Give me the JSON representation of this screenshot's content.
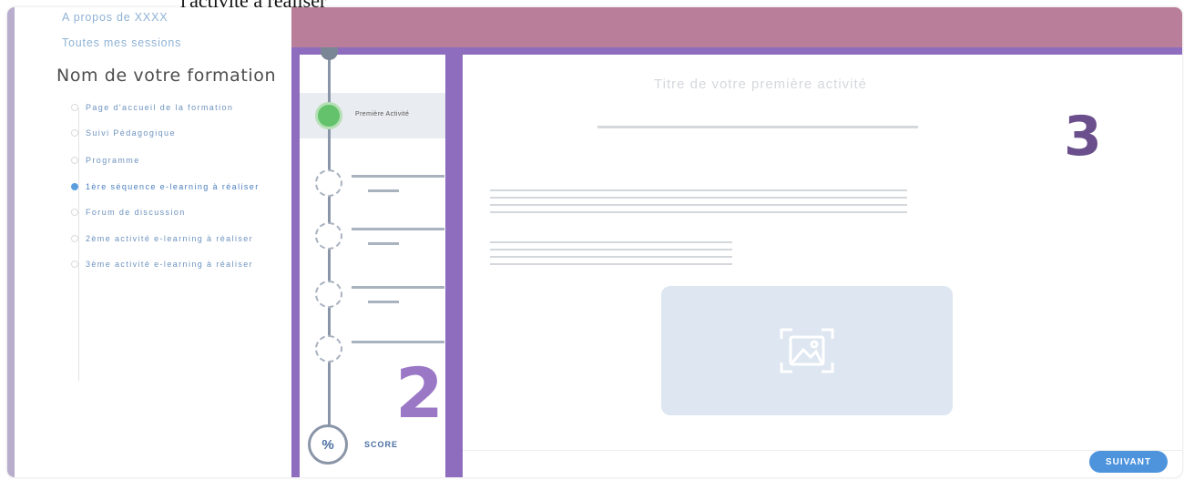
{
  "snippet_text": "l'activité à réaliser",
  "nav": {
    "links": [
      "A propos de XXXX",
      "Toutes mes sessions"
    ],
    "course_title": "Nom de votre formation",
    "items": [
      {
        "label": "Page d'accueil de la formation",
        "active": false
      },
      {
        "label": "Suivi Pédagogique",
        "active": false
      },
      {
        "label": "Programme",
        "active": false
      },
      {
        "label": "1ère séquence e-learning à réaliser",
        "active": true
      },
      {
        "label": "Forum de discussion",
        "active": false
      },
      {
        "label": "2ème activité e-learning à réaliser",
        "active": false
      },
      {
        "label": "3ème activité e-learning à réaliser",
        "active": false
      }
    ]
  },
  "stepper": {
    "first_step_label": "Première Activité",
    "score_symbol": "%",
    "score_label": "SCORE",
    "callout_number": "2"
  },
  "content": {
    "activity_title": "Titre de votre première activité",
    "callout_number": "3",
    "image_icon": "image-icon"
  },
  "footer": {
    "next_label": "SUIVANT"
  },
  "colors": {
    "header_band": "#b97f9a",
    "stepper_border": "#8e6dbf",
    "completed_step": "#63c26b",
    "next_button": "#4d94dd"
  }
}
